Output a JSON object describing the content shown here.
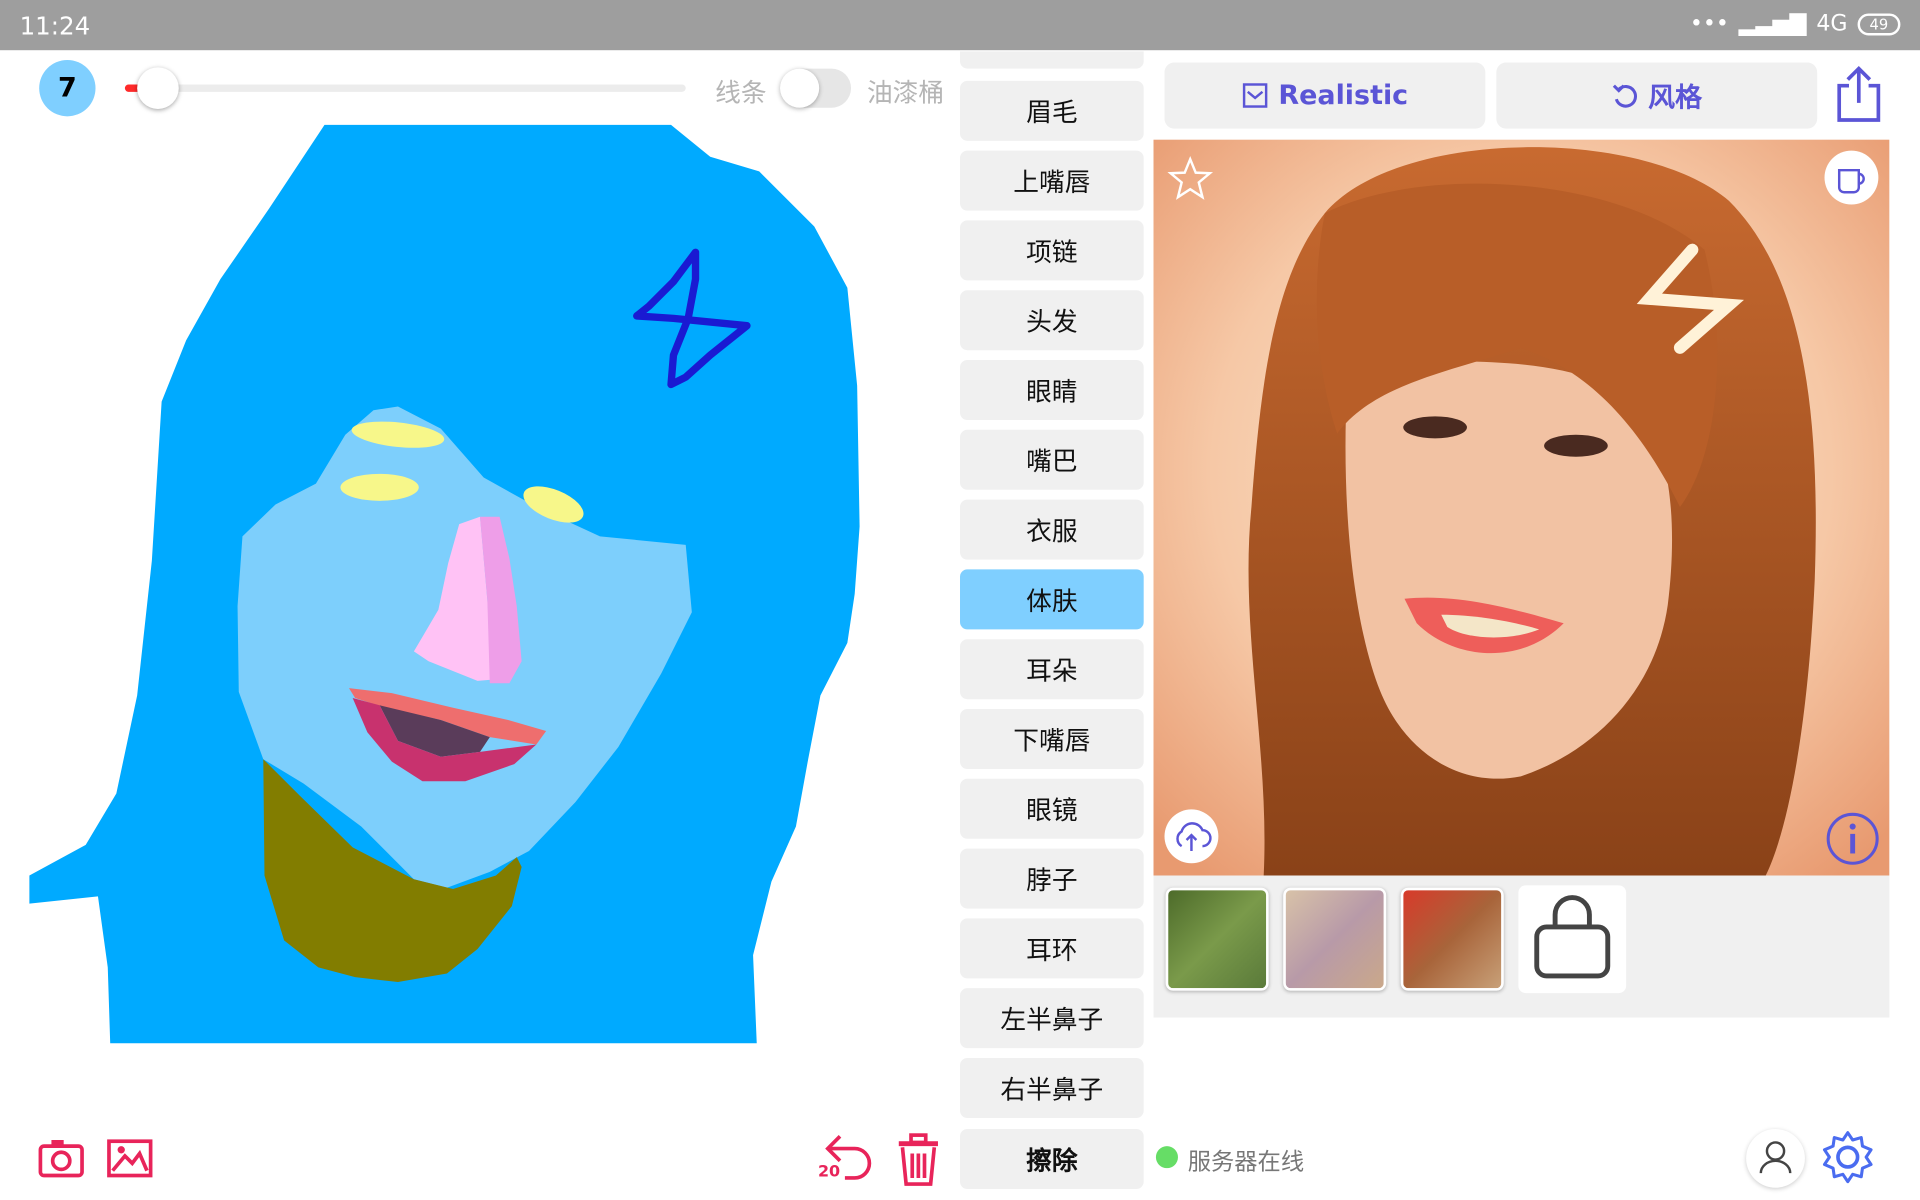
{
  "status_bar": {
    "time": "11:24",
    "network": "4G",
    "battery": "49"
  },
  "brush": {
    "size": "7",
    "slider_fraction": 0.03
  },
  "mode": {
    "line_label": "线条",
    "fill_label": "油漆桶",
    "toggle_on": false
  },
  "labels": {
    "items": [
      {
        "label": "眉毛",
        "active": false
      },
      {
        "label": "上嘴唇",
        "active": false
      },
      {
        "label": "项链",
        "active": false
      },
      {
        "label": "头发",
        "active": false
      },
      {
        "label": "眼睛",
        "active": false
      },
      {
        "label": "嘴巴",
        "active": false
      },
      {
        "label": "衣服",
        "active": false
      },
      {
        "label": "体肤",
        "active": true
      },
      {
        "label": "耳朵",
        "active": false
      },
      {
        "label": "下嘴唇",
        "active": false
      },
      {
        "label": "眼镜",
        "active": false
      },
      {
        "label": "脖子",
        "active": false
      },
      {
        "label": "耳环",
        "active": false
      },
      {
        "label": "左半鼻子",
        "active": false
      },
      {
        "label": "右半鼻子",
        "active": false
      }
    ],
    "erase": "擦除"
  },
  "toolbar": {
    "undo_count": "20"
  },
  "right_panel": {
    "realistic_label": "Realistic",
    "style_label": "风格",
    "server_status": "服务器在线"
  },
  "colors": {
    "brand_blue": "#7fcfff",
    "accent_purple": "#5b55d6",
    "tool_pink": "#e8245a",
    "hair_blue": "#00aaff",
    "skin_light_blue": "#7dcffc",
    "online_green": "#66dd66"
  }
}
